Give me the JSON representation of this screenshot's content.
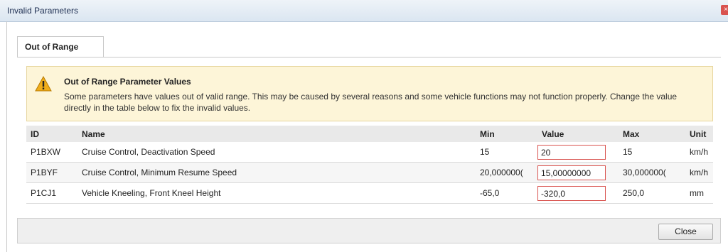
{
  "window": {
    "title": "Invalid Parameters",
    "close_glyph": "×"
  },
  "tab": {
    "label": "Out of Range"
  },
  "warning": {
    "icon": "warning-icon",
    "title": "Out of Range Parameter Values",
    "text": "Some parameters have values out of valid range. This may be caused by several reasons and some vehicle functions may not function properly. Change the value directly in the table below to fix the invalid values."
  },
  "table": {
    "headers": {
      "id": "ID",
      "name": "Name",
      "min": "Min",
      "value": "Value",
      "max": "Max",
      "unit": "Unit"
    },
    "rows": [
      {
        "id": "P1BXW",
        "name": "Cruise Control, Deactivation Speed",
        "min": "15",
        "value": "20",
        "max": "15",
        "unit": "km/h"
      },
      {
        "id": "P1BYF",
        "name": "Cruise Control, Minimum Resume Speed",
        "min": "20,000000(",
        "value": "15,00000000",
        "max": "30,000000(",
        "unit": "km/h"
      },
      {
        "id": "P1CJ1",
        "name": "Vehicle Kneeling, Front Kneel Height",
        "min": "-65,0",
        "value": "-320,0",
        "max": "250,0",
        "unit": "mm"
      }
    ]
  },
  "footer": {
    "close_label": "Close"
  },
  "colors": {
    "invalid_border": "#d9534f",
    "warning_bg": "#fdf5d8",
    "warning_icon": "#f0ad1a"
  }
}
